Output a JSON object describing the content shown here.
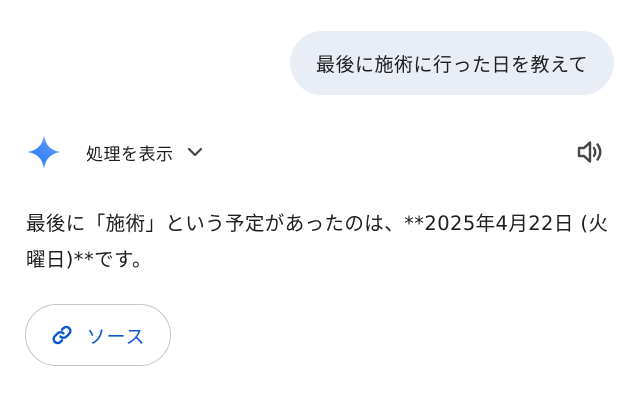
{
  "user_message": {
    "text": "最後に施術に行った日を教えて"
  },
  "response": {
    "header": {
      "thinking_label": "処理を表示",
      "icons": {
        "assistant": "gemini-spark-icon",
        "expand": "chevron-down-icon",
        "speaker": "speaker-icon"
      }
    },
    "answer_text": "最後に「施術」という予定があったのは、**2025年4月22日 (火曜日)**です。",
    "source_chip": {
      "label": "ソース",
      "icon": "link-icon"
    }
  },
  "colors": {
    "user_bubble_bg": "#e9eef6",
    "link_blue": "#0b57d0",
    "text": "#1f1f1f",
    "chip_border": "#c4c7c5"
  }
}
